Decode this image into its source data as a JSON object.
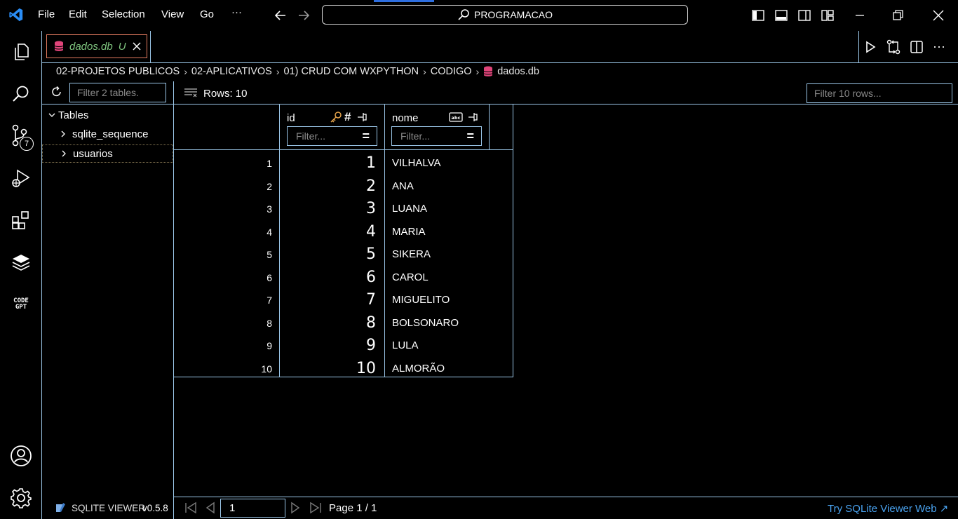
{
  "titlebar": {
    "menu": [
      "File",
      "Edit",
      "Selection",
      "View",
      "Go",
      "···"
    ],
    "search_text": "PROGRAMACAO"
  },
  "activitybar": {
    "source_control_badge": "7",
    "codegpt_label_top": "CODE",
    "codegpt_label_bottom": "GPT"
  },
  "tab": {
    "filename": "dados.db",
    "status": "U"
  },
  "breadcrumb": [
    "02-PROJETOS PUBLICOS",
    "02-APLICATIVOS",
    "01) CRUD COM WXPYTHON",
    "CODIGO",
    "dados.db"
  ],
  "sidebar": {
    "filter_placeholder": "Filter 2 tables.",
    "tables_header": "Tables",
    "tables": [
      "sqlite_sequence",
      "usuarios"
    ]
  },
  "main": {
    "rows_label": "Rows: 10",
    "filter_rows_placeholder": "Filter 10 rows...",
    "columns": [
      {
        "name": "id",
        "filter_placeholder": "Filter..."
      },
      {
        "name": "nome",
        "filter_placeholder": "Filter..."
      }
    ],
    "rows": [
      {
        "n": "1",
        "id": "1",
        "nome": "VILHALVA"
      },
      {
        "n": "2",
        "id": "2",
        "nome": "ANA"
      },
      {
        "n": "3",
        "id": "3",
        "nome": "LUANA"
      },
      {
        "n": "4",
        "id": "4",
        "nome": "MARIA"
      },
      {
        "n": "5",
        "id": "5",
        "nome": "SIKERA"
      },
      {
        "n": "6",
        "id": "6",
        "nome": "CAROL"
      },
      {
        "n": "7",
        "id": "7",
        "nome": "MIGUELITO"
      },
      {
        "n": "8",
        "id": "8",
        "nome": "BOLSONARO"
      },
      {
        "n": "9",
        "id": "9",
        "nome": "LULA"
      },
      {
        "n": "10",
        "id": "10",
        "nome": "ALMORÃO"
      }
    ]
  },
  "footer": {
    "extension_name": "SQLITE VIEWER",
    "version": "v0.5.8",
    "page_value": "1",
    "page_label": "Page 1 / 1",
    "web_link": "Try SQLite Viewer Web ↗"
  },
  "colors": {
    "border": "#9bc6e8",
    "tab_border": "#e07a5f",
    "italic_tab": "#7fc57f",
    "db_icon": "#e0457a",
    "link": "#4aa3f0",
    "key_icon": "#e8a54b"
  }
}
